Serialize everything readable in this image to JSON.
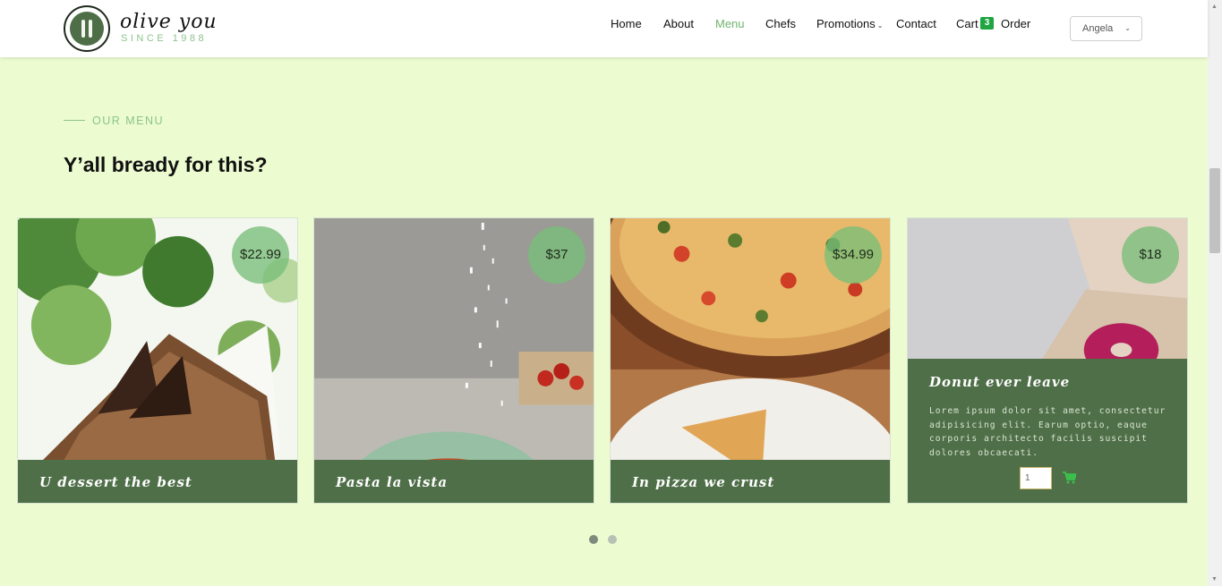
{
  "header": {
    "logo_title": "olive you",
    "logo_subtitle": "SINCE 1988",
    "nav": [
      {
        "label": "Home"
      },
      {
        "label": "About"
      },
      {
        "label": "Menu"
      },
      {
        "label": "Chefs"
      },
      {
        "label": "Promotions"
      },
      {
        "label": "Contact"
      },
      {
        "label": "Cart"
      },
      {
        "label": "Order"
      }
    ],
    "active_nav": "Menu",
    "cart_count": "3",
    "user": "Angela"
  },
  "section": {
    "eyebrow": "OUR MENU",
    "title": "Y’all bready for this?"
  },
  "cards": [
    {
      "title": "U dessert the best",
      "price": "$22.99"
    },
    {
      "title": "Pasta la vista",
      "price": "$37"
    },
    {
      "title": "In pizza we crust",
      "price": "$34.99"
    },
    {
      "title": "Donut ever leave",
      "price": "$18",
      "description": "Lorem ipsum dolor sit amet, consectetur adipisicing elit. Earum optio, eaque corporis architecto facilis suscipit dolores obcaecati.",
      "quantity": "1"
    }
  ],
  "carousel": {
    "pages": 2,
    "active_page": 1
  },
  "colors": {
    "accent_green": "#8cc48d",
    "active_nav": "#6fb66e",
    "caption_bg": "#4f6f48",
    "page_bg": "#ecfbd0",
    "badge": "#1fa541"
  }
}
